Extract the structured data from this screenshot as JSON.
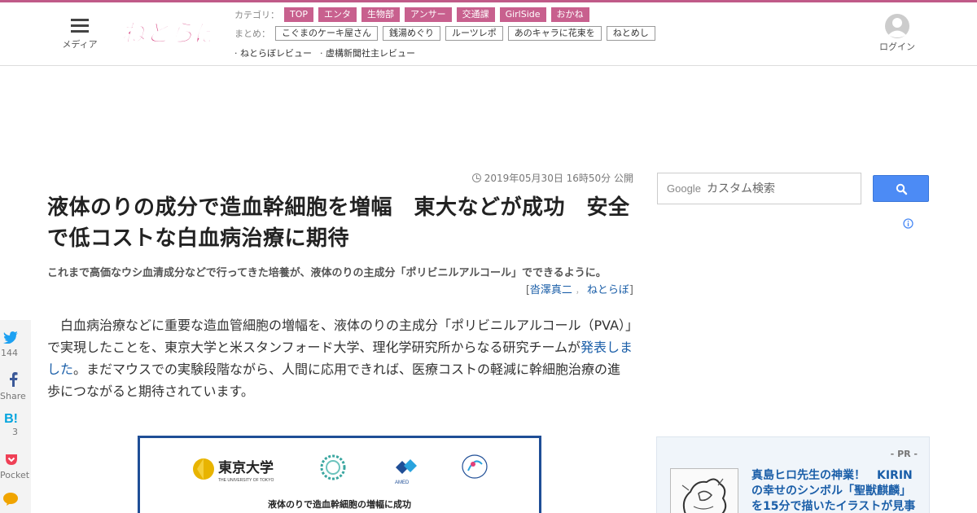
{
  "header": {
    "menu_label": "メディア",
    "logo_text": "ねとらぼ",
    "category_label": "カテゴリ：",
    "categories": [
      "TOP",
      "エンタ",
      "生物部",
      "アンサー",
      "交通課",
      "GirlSide",
      "おかね"
    ],
    "summary_label": "まとめ：",
    "summaries": [
      "こぐまのケーキ屋さん",
      "銭湯めぐり",
      "ルーツレポ",
      "あのキャラに花束を",
      "ねとめし"
    ],
    "reviews": [
      "· ねとらぼレビュー",
      "· 虚構新聞社主レビュー"
    ],
    "login_label": "ログイン"
  },
  "article": {
    "pubdate": "2019年05月30日 16時50分 公開",
    "headline": "液体のりの成分で造血幹細胞を増幅　東大などが成功　安全で低コストな白血病治療に期待",
    "subhead": "これまで高価なウシ血清成分などで行ってきた培養が、液体のりの主成分「ポリビニルアルコール」でできるように。",
    "byline_open": "[",
    "author": "沓澤真二",
    "byline_sep": "，",
    "publisher": "ねとらぼ",
    "byline_close": "]",
    "body_before_link": "白血病治療などに重要な造血管細胞の増幅を、液体のりの主成分「ポリビニルアルコール（PVA）」で実現したことを、東京大学と米スタンフォード大学、理化学研究所からなる研究チームが",
    "body_link": "発表しました",
    "body_after_link": "。まだマウスでの実験段階ながら、人間に応用できれば、医療コストの軽減に幹細胞治療の進歩につながると期待されています。",
    "figure": {
      "university_name": "東京大学",
      "university_name_en": "THE UNIVERSITY OF TOKYO",
      "amed_label": "AMED",
      "caption": "液体のりで造血幹細胞の増幅に成功"
    }
  },
  "share": {
    "twitter_count": "144",
    "facebook_label": "Share",
    "hatena_label": "B!",
    "hatena_count": "3",
    "pocket_label": "Pocket"
  },
  "search": {
    "brand": "Google",
    "placeholder": "カスタム検索"
  },
  "sidebar": {
    "pr_label": "- PR -",
    "pr_title": "真島ヒロ先生の神業！　KIRINの幸せのシンボル「聖獣麒麟」を15分で描いたイラストが見事"
  },
  "colors": {
    "brand_pink": "#c8608e",
    "link_blue": "#1a5ea8",
    "search_blue": "#4c8bf5",
    "figure_border": "#1f4e96"
  }
}
